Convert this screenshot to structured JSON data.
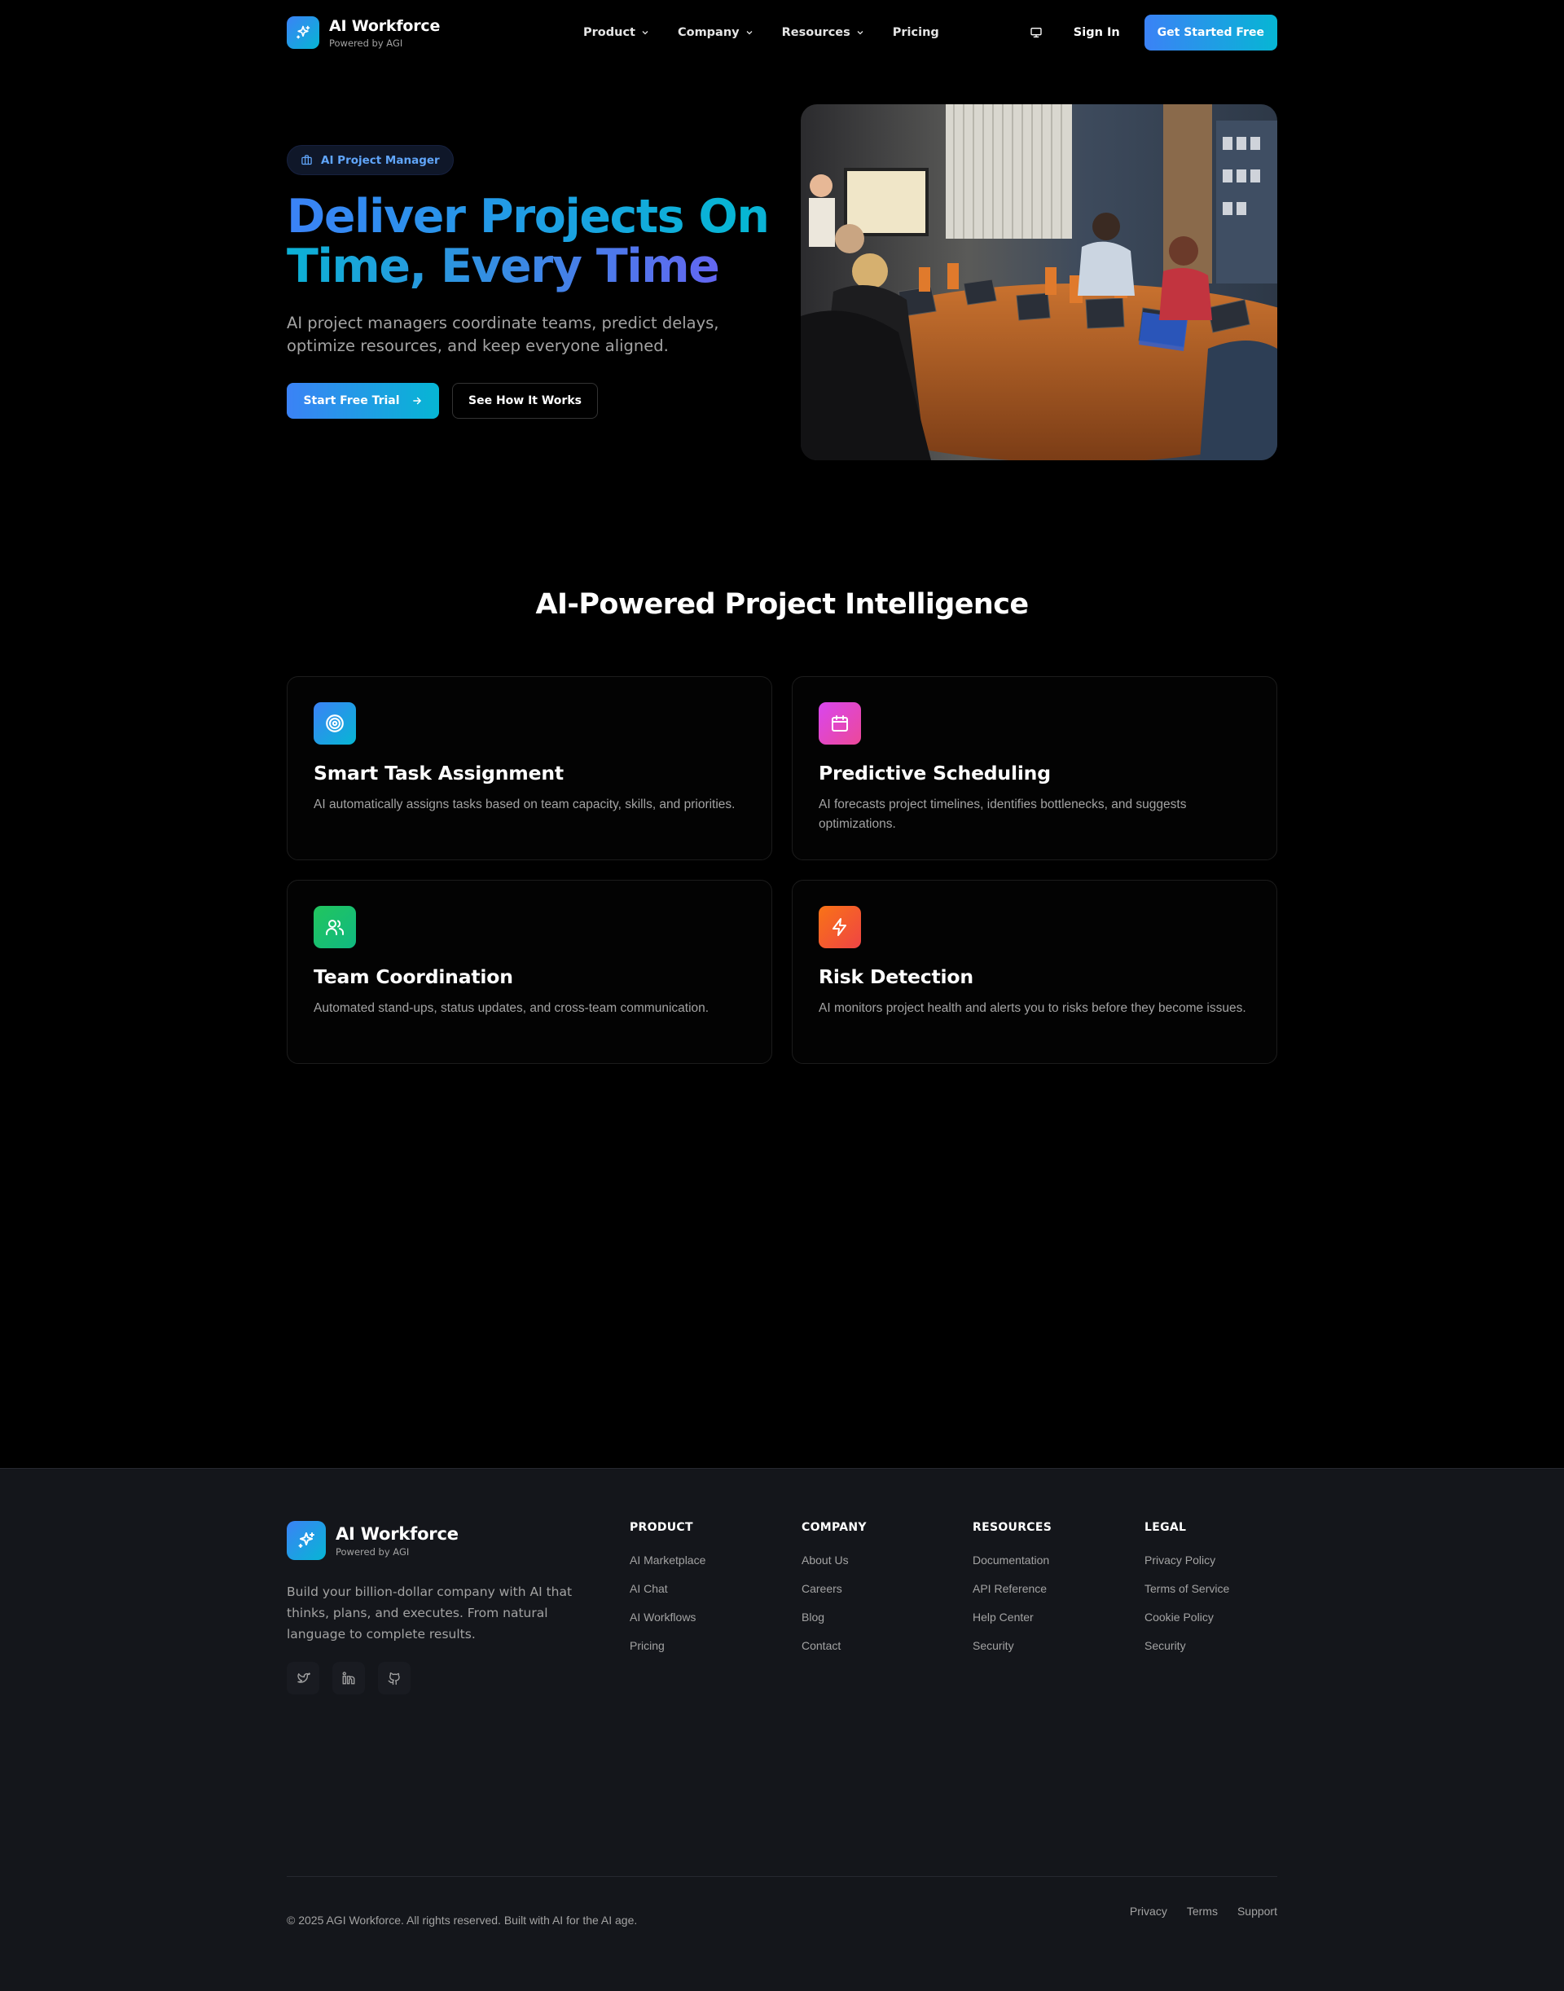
{
  "header": {
    "brand": "AI Workforce",
    "brand_sub": "Powered by AGI",
    "nav": [
      {
        "label": "Product",
        "icon": "chevron-down-icon"
      },
      {
        "label": "Company",
        "icon": "chevron-down-icon"
      },
      {
        "label": "Resources",
        "icon": "chevron-down-icon"
      },
      {
        "label": "Pricing"
      }
    ],
    "signin": "Sign In",
    "cta": "Get Started Free"
  },
  "hero": {
    "badge": "AI Project Manager",
    "title": "Deliver Projects On Time, Every Time",
    "description": "AI project managers coordinate teams, predict delays, optimize resources, and keep everyone aligned.",
    "primary_button": "Start Free Trial",
    "secondary_button": "See How It Works"
  },
  "features": {
    "title": "AI-Powered Project Intelligence",
    "cards": [
      {
        "title": "Smart Task Assignment",
        "description": "AI automatically assigns tasks based on team capacity, skills, and priorities.",
        "icon": "target-icon",
        "color": "#3b82f6"
      },
      {
        "title": "Predictive Scheduling",
        "description": "AI forecasts project timelines, identifies bottlenecks, and suggests optimizations.",
        "icon": "calendar-icon",
        "color": "#d946ef"
      },
      {
        "title": "Team Coordination",
        "description": "Automated stand-ups, status updates, and cross-team communication.",
        "icon": "users-icon",
        "color": "#22c55e"
      },
      {
        "title": "Risk Detection",
        "description": "AI monitors project health and alerts you to risks before they become issues.",
        "icon": "lightning-icon",
        "color": "#f97316"
      }
    ]
  },
  "footer": {
    "brand": "AI Workforce",
    "brand_sub": "Powered by AGI",
    "description": "Build your billion-dollar company with AI that thinks, plans, and executes. From natural language to complete results.",
    "socials": [
      "twitter-icon",
      "linkedin-icon",
      "github-icon"
    ],
    "columns": [
      {
        "heading": "PRODUCT",
        "links": [
          "AI Marketplace",
          "AI Chat",
          "AI Workflows",
          "Pricing"
        ]
      },
      {
        "heading": "COMPANY",
        "links": [
          "About Us",
          "Careers",
          "Blog",
          "Contact"
        ]
      },
      {
        "heading": "RESOURCES",
        "links": [
          "Documentation",
          "API Reference",
          "Help Center",
          "Security"
        ]
      },
      {
        "heading": "LEGAL",
        "links": [
          "Privacy Policy",
          "Terms of Service",
          "Cookie Policy",
          "Security"
        ]
      }
    ],
    "copyright": "© 2025 AGI Workforce. All rights reserved. Built with AI for the AI age.",
    "bottom_links": [
      "Privacy",
      "Terms",
      "Support"
    ]
  }
}
